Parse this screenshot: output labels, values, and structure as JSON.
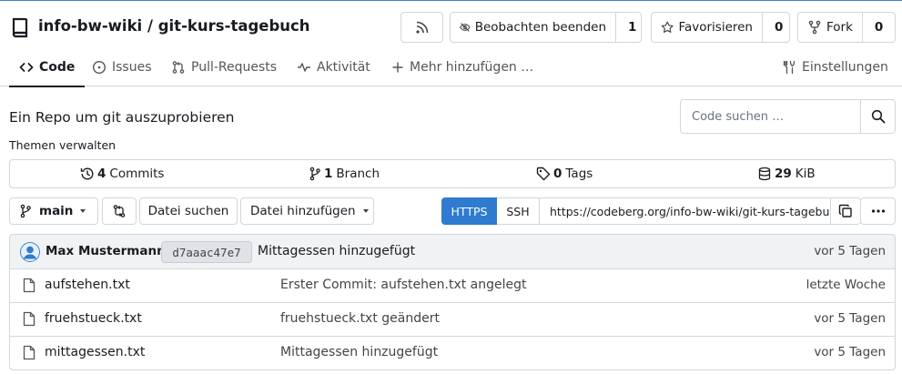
{
  "repo": {
    "title": "info-bw-wiki / git-kurs-tagebuch",
    "description": "Ein Repo um git auszuprobieren",
    "topics_label": "Themen verwalten"
  },
  "header_actions": {
    "rss_icon": "rss-icon",
    "watch": {
      "label": "Beobachten beenden",
      "count": "1",
      "icon": "eye-slash-icon"
    },
    "star": {
      "label": "Favorisieren",
      "count": "0",
      "icon": "star-icon"
    },
    "fork": {
      "label": "Fork",
      "count": "0",
      "icon": "fork-icon"
    }
  },
  "tabs": [
    {
      "label": "Code",
      "icon": "code-icon",
      "active": true
    },
    {
      "label": "Issues",
      "icon": "issue-icon"
    },
    {
      "label": "Pull-Requests",
      "icon": "pull-request-icon"
    },
    {
      "label": "Aktivität",
      "icon": "pulse-icon"
    },
    {
      "label": "Mehr hinzufügen …",
      "icon": "plus-icon"
    },
    {
      "label": "Einstellungen",
      "icon": "tools-icon"
    }
  ],
  "search": {
    "placeholder": "Code suchen …"
  },
  "stats": {
    "commits": {
      "count": "4",
      "label": "Commits"
    },
    "branches": {
      "count": "1",
      "label": "Branch"
    },
    "tags": {
      "count": "0",
      "label": "Tags"
    },
    "size": {
      "value": "29",
      "unit": "KiB"
    }
  },
  "toolbar": {
    "branch": "main",
    "find_file": "Datei suchen",
    "add_file": "Datei hinzufügen"
  },
  "clone": {
    "https_label": "HTTPS",
    "ssh_label": "SSH",
    "url": "https://codeberg.org/info-bw-wiki/git-kurs-tagebuch"
  },
  "latest_commit": {
    "author": "Max Mustermann",
    "sha": "d7aaac47e7",
    "message": "Mittagessen hinzugefügt",
    "time": "vor 5 Tagen"
  },
  "files": [
    {
      "name": "aufstehen.txt",
      "message": "Erster Commit: aufstehen.txt angelegt",
      "time": "letzte Woche"
    },
    {
      "name": "fruehstueck.txt",
      "message": "fruehstueck.txt geändert",
      "time": "vor 5 Tagen"
    },
    {
      "name": "mittagessen.txt",
      "message": "Mittagessen hinzugefügt",
      "time": "vor 5 Tagen"
    }
  ],
  "colors": {
    "accent": "#2e7bcf",
    "border": "#d0d7de",
    "commit_bar": "#f0f2f4"
  }
}
